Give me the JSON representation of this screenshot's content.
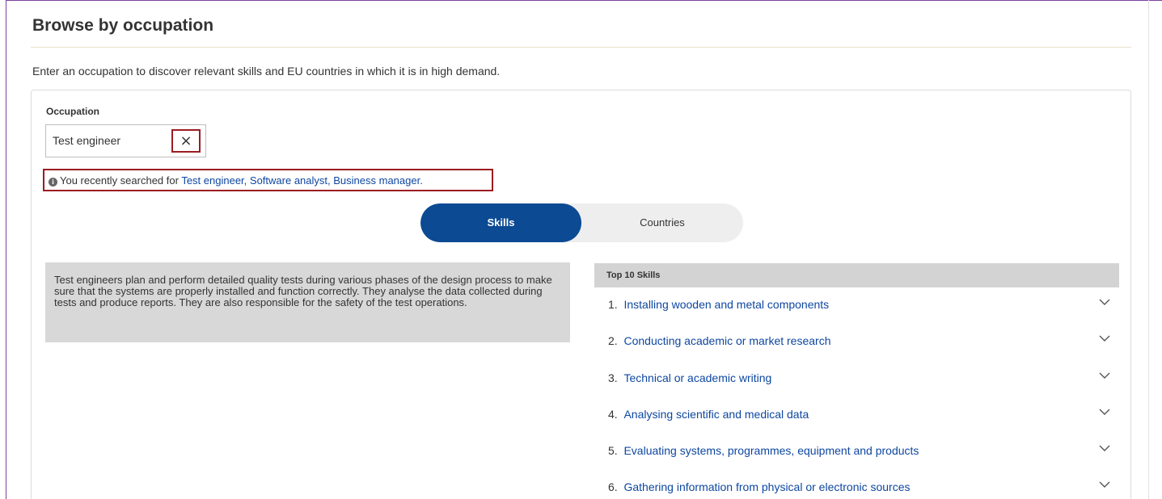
{
  "page": {
    "title": "Browse by occupation",
    "intro": "Enter an occupation to discover relevant skills and EU countries in which it is in high demand."
  },
  "occupation": {
    "label": "Occupation",
    "value": "Test engineer",
    "clear_label": "×"
  },
  "recent": {
    "prefix": "You recently searched for ",
    "items": [
      "Test engineer",
      "Software analyst",
      "Business manager"
    ],
    "separator": ", ",
    "suffix": "."
  },
  "toggle": {
    "skills_label": "Skills",
    "countries_label": "Countries",
    "active": "Skills"
  },
  "description": "Test engineers plan and perform detailed quality tests during various phases of the design process to make sure that the systems are properly installed and function correctly. They analyse the data collected during tests and produce reports. They are also responsible for the safety of the test operations.",
  "skills": {
    "header": "Top 10 Skills",
    "items": [
      {
        "num": "1.",
        "label": "Installing wooden and metal components"
      },
      {
        "num": "2.",
        "label": "Conducting academic or market research"
      },
      {
        "num": "3.",
        "label": "Technical or academic writing"
      },
      {
        "num": "4.",
        "label": "Analysing scientific and medical data"
      },
      {
        "num": "5.",
        "label": "Evaluating systems, programmes, equipment and products"
      },
      {
        "num": "6.",
        "label": "Gathering information from physical or electronic sources"
      }
    ]
  },
  "colors": {
    "accent": "#0c4a93",
    "link": "#0e47a1",
    "highlight_border": "#9b1c22",
    "frame": "#7b3fa0"
  },
  "icons": {
    "info": "info-circle-icon",
    "clear": "close-icon",
    "expand": "chevron-down-icon"
  }
}
